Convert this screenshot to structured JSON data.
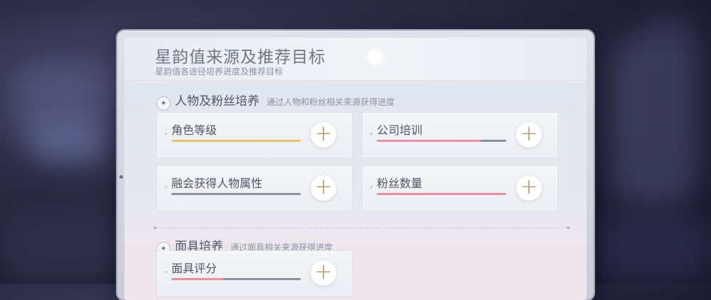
{
  "panel": {
    "title": "星韵值来源及推荐目标",
    "subtitle": "星韵值各途径培养进度及推荐目标"
  },
  "sections": [
    {
      "title": "人物及粉丝培养",
      "desc": "通过人物和粉丝相关来源获得进度",
      "cards": [
        {
          "label": "角色等级",
          "progress": 1.0,
          "color": "#e7c46e"
        },
        {
          "label": "公司培训",
          "progress": 0.8,
          "color": "#e98fa3"
        },
        {
          "label": "融会获得人物属性",
          "progress": 0.0,
          "color": "#e98fa3"
        },
        {
          "label": "粉丝数量",
          "progress": 1.0,
          "color": "#e98fa3"
        }
      ]
    },
    {
      "title": "面具培养",
      "desc": "通过面具相关来源获得进度",
      "cards": [
        {
          "label": "面具评分",
          "progress": 0.4,
          "color": "#e98fa3"
        }
      ]
    }
  ],
  "icons": {
    "section": "sparkle-icon",
    "add": "plus-icon"
  },
  "add_glyph": "+",
  "sparkle_glyph": "✦"
}
